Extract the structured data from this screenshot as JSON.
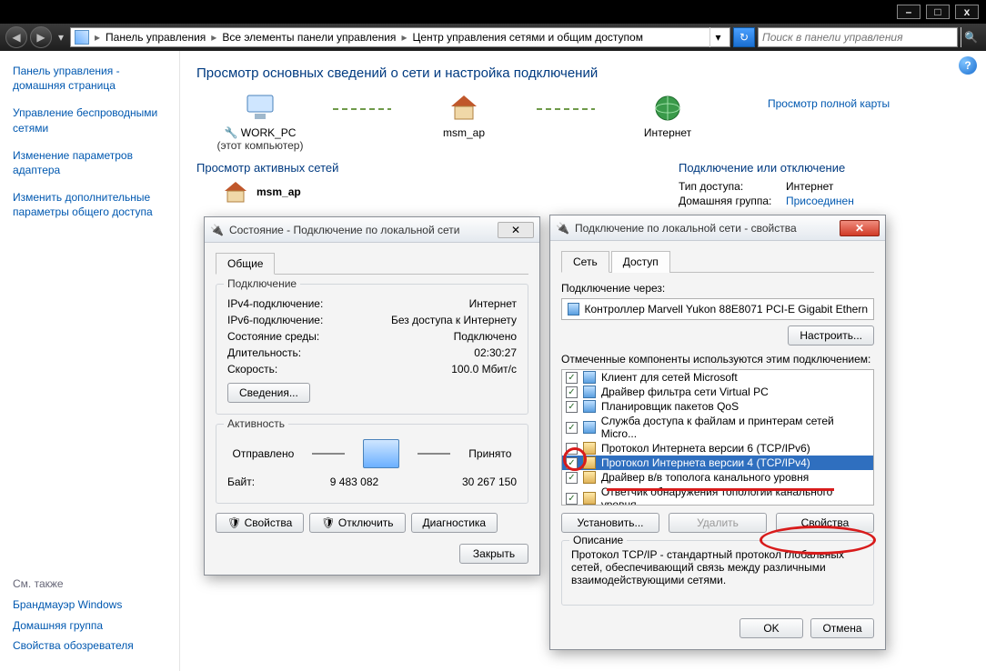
{
  "chrome": {
    "min": "–",
    "max": "□",
    "close": "x",
    "nav_back": "◀",
    "nav_fwd": "▶",
    "hist": "▾",
    "crumbs": [
      "Панель управления",
      "Все элементы панели управления",
      "Центр управления сетями и общим доступом"
    ],
    "sep": "▸",
    "addr_dd": "▾",
    "refresh": "↻",
    "search_placeholder": "Поиск в панели управления",
    "search_go": "🔍"
  },
  "sidebar": {
    "links": [
      "Панель управления - домашняя страница",
      "Управление беспроводными сетями",
      "Изменение параметров адаптера",
      "Изменить дополнительные параметры общего доступа"
    ],
    "see_also_title": "См. также",
    "see_also": [
      "Брандмауэр Windows",
      "Домашняя группа",
      "Свойства обозревателя"
    ]
  },
  "main": {
    "heading": "Просмотр основных сведений о сети и настройка подключений",
    "map_link": "Просмотр полной карты",
    "nodes": {
      "pc": "WORK_PC",
      "pc_sub": "(этот компьютер)",
      "ap": "msm_ap",
      "inet": "Интернет"
    },
    "active_title": "Просмотр активных сетей",
    "connect_title": "Подключение или отключение",
    "ap_item": "msm_ap",
    "kv": {
      "k1": "Тип доступа:",
      "v1": "Интернет",
      "k2": "Домашняя группа:",
      "v2": "Присоединен"
    }
  },
  "status": {
    "title": "Состояние - Подключение по локальной сети",
    "close_x": "✕",
    "tab_general": "Общие",
    "grp_conn": "Подключение",
    "rows": [
      {
        "k": "IPv4-подключение:",
        "v": "Интернет"
      },
      {
        "k": "IPv6-подключение:",
        "v": "Без доступа к Интернету"
      },
      {
        "k": "Состояние среды:",
        "v": "Подключено"
      },
      {
        "k": "Длительность:",
        "v": "02:30:27"
      },
      {
        "k": "Скорость:",
        "v": "100.0 Мбит/с"
      }
    ],
    "details_btn": "Сведения...",
    "grp_activity": "Активность",
    "sent": "Отправлено",
    "recv": "Принято",
    "bytes_label": "Байт:",
    "bytes_sent": "9 483 082",
    "bytes_recv": "30 267 150",
    "props_btn": "Свойства",
    "disable_btn": "Отключить",
    "diag_btn": "Диагностика",
    "close_btn": "Закрыть"
  },
  "props": {
    "title": "Подключение по локальной сети - свойства",
    "close_x": "✕",
    "tab_net": "Сеть",
    "tab_access": "Доступ",
    "conn_via": "Подключение через:",
    "adapter": "Контроллер Marvell Yukon 88E8071 PCI-E Gigabit Ethern",
    "configure_btn": "Настроить...",
    "comp_label": "Отмеченные компоненты используются этим подключением:",
    "components": [
      {
        "checked": true,
        "ico": "net",
        "label": "Клиент для сетей Microsoft"
      },
      {
        "checked": true,
        "ico": "net",
        "label": "Драйвер фильтра сети Virtual PC"
      },
      {
        "checked": true,
        "ico": "net",
        "label": "Планировщик пакетов QoS"
      },
      {
        "checked": true,
        "ico": "net",
        "label": "Служба доступа к файлам и принтерам сетей Micro..."
      },
      {
        "checked": false,
        "ico": "svc",
        "label": "Протокол Интернета версии 6 (TCP/IPv6)"
      },
      {
        "checked": true,
        "ico": "svc",
        "label": "Протокол Интернета версии 4 (TCP/IPv4)",
        "selected": true
      },
      {
        "checked": true,
        "ico": "svc",
        "label": "Драйвер в/в тополога канального уровня"
      },
      {
        "checked": true,
        "ico": "svc",
        "label": "Ответчик обнаружения топологии канального уровня"
      }
    ],
    "install_btn": "Установить...",
    "remove_btn": "Удалить",
    "props_btn": "Свойства",
    "desc_title": "Описание",
    "desc_text": "Протокол TCP/IP - стандартный протокол глобальных сетей, обеспечивающий связь между различными взаимодействующими сетями.",
    "ok_btn": "OK",
    "cancel_btn": "Отмена"
  }
}
